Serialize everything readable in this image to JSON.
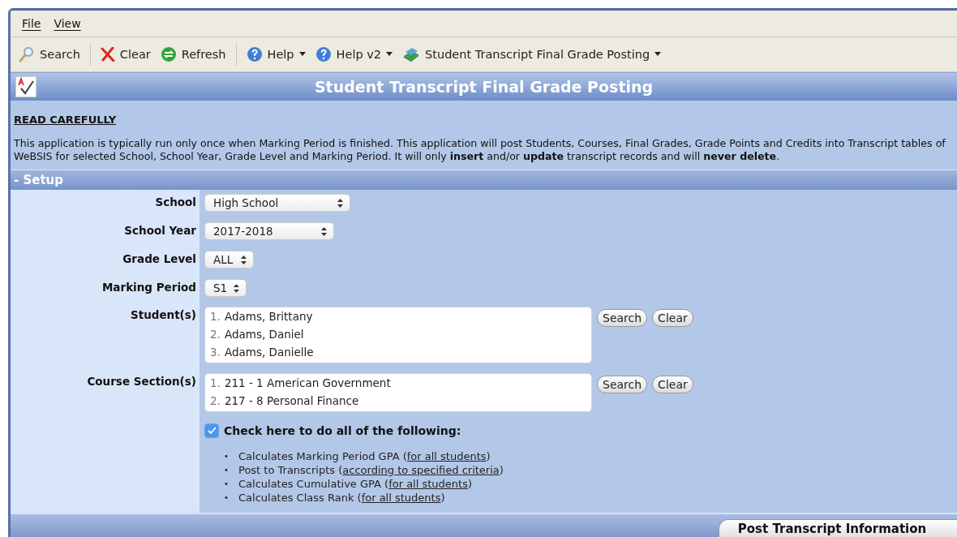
{
  "menu": [
    "File",
    "View"
  ],
  "toolbar": [
    {
      "kind": "search",
      "label": "Search",
      "dropdown": false,
      "separator_after": true
    },
    {
      "kind": "clear",
      "label": "Clear",
      "dropdown": false,
      "separator_after": false
    },
    {
      "kind": "refresh",
      "label": "Refresh",
      "dropdown": false,
      "separator_after": true
    },
    {
      "kind": "help",
      "label": "Help",
      "dropdown": true,
      "separator_after": false
    },
    {
      "kind": "help",
      "label": "Help v2",
      "dropdown": true,
      "separator_after": false
    },
    {
      "kind": "app",
      "label": "Student Transcript Final Grade Posting",
      "dropdown": true,
      "separator_after": false
    }
  ],
  "page_title": "Student Transcript Final Grade Posting",
  "notice": {
    "heading": "READ CAREFULLY",
    "text": "This application is typically run only once when Marking Period is finished. This application will post Students, Courses, Final Grades, Grade Points and Credits into Transcript tables of WeBSIS for selected School, School Year, Grade Level and Marking Period. It will only **insert** and/or **update** transcript records and will **never delete**."
  },
  "section": {
    "title": "- Setup",
    "expanded": true
  },
  "fields": [
    {
      "kind": "select",
      "label": "School",
      "value": "High School"
    },
    {
      "kind": "select",
      "label": "School Year",
      "value": "2017-2018"
    },
    {
      "kind": "select",
      "label": "Grade Level",
      "value": "ALL"
    },
    {
      "kind": "select",
      "label": "Marking Period",
      "value": "S1"
    },
    {
      "kind": "list",
      "label": "Student(s)",
      "items": [
        {
          "number": "1.",
          "text": "Adams, Brittany"
        },
        {
          "number": "2.",
          "text": "Adams, Daniel"
        },
        {
          "number": "3.",
          "text": "Adams, Danielle"
        }
      ],
      "buttons": [
        "Search",
        "Clear"
      ]
    },
    {
      "kind": "list",
      "label": "Course Section(s)",
      "items": [
        {
          "number": "1.",
          "text": "211 - 1 American Government"
        },
        {
          "number": "2.",
          "text": "217 - 8 Personal Finance"
        }
      ],
      "buttons": [
        "Search",
        "Clear"
      ]
    }
  ],
  "do_all": {
    "label": "Check here to do all of the following:",
    "checked": true
  },
  "actions": [
    {
      "bullet": "•",
      "before": "Calculates Marking Period GPA (",
      "link": "for all students",
      "after": ")"
    },
    {
      "bullet": "•",
      "before": "Post to Transcripts (",
      "link": "according to specified criteria",
      "after": ")"
    },
    {
      "bullet": "•",
      "before": "Calculates Cumulative GPA (",
      "link": "for all students",
      "after": ")"
    },
    {
      "bullet": "•",
      "before": "Calculates Class Rank (",
      "link": "for all students",
      "after": ")"
    }
  ],
  "submit": "Post Transcript Information"
}
